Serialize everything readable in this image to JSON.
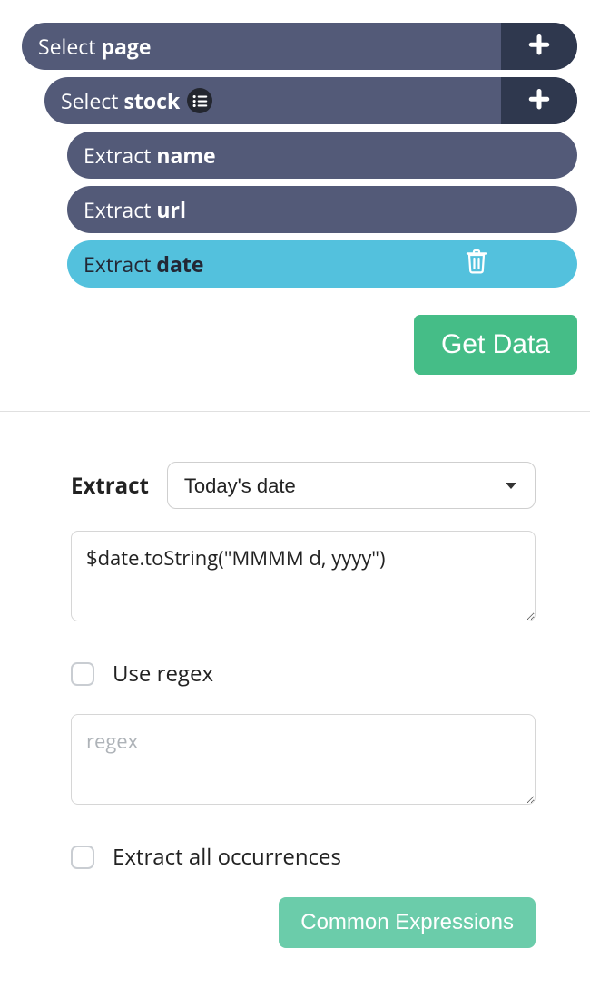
{
  "tree": {
    "select_page": {
      "action": "Select",
      "target": "page"
    },
    "select_stock": {
      "action": "Select",
      "target": "stock"
    },
    "extract_name": {
      "action": "Extract",
      "target": "name"
    },
    "extract_url": {
      "action": "Extract",
      "target": "url"
    },
    "extract_date": {
      "action": "Extract",
      "target": "date"
    }
  },
  "buttons": {
    "get_data": "Get Data",
    "common_expressions": "Common Expressions"
  },
  "form": {
    "extract_label": "Extract",
    "select_value": "Today's date",
    "expression_value": "$date.toString(\"MMMM d, yyyy\")",
    "use_regex_label": "Use regex",
    "regex_placeholder": "regex",
    "extract_all_label": "Extract all occurrences"
  }
}
